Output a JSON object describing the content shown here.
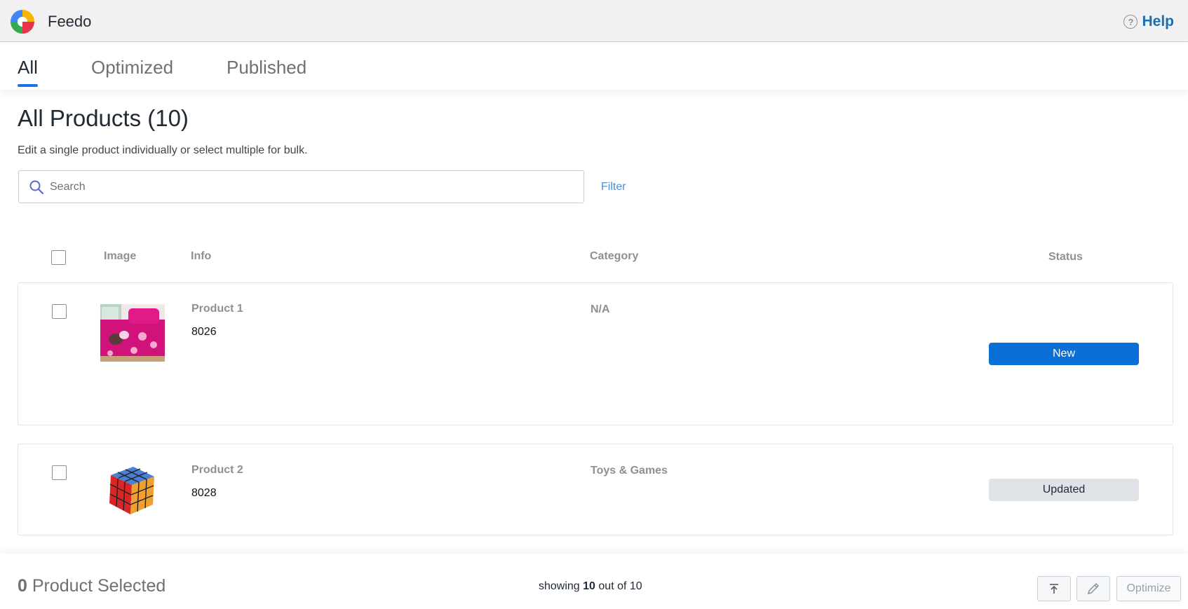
{
  "app": {
    "title": "Feedo",
    "logo_icon": "feedo-logo-icon"
  },
  "help": {
    "label": "Help",
    "icon": "question-circle-icon"
  },
  "tabs": [
    {
      "label": "All",
      "active": true
    },
    {
      "label": "Optimized",
      "active": false
    },
    {
      "label": "Published",
      "active": false
    }
  ],
  "page": {
    "title": "All Products (10)",
    "subtitle": "Edit a single product individually or select multiple for bulk."
  },
  "search": {
    "placeholder": "Search",
    "value": "",
    "icon": "search-icon"
  },
  "filter": {
    "label": "Filter"
  },
  "table": {
    "headers": {
      "image": "Image",
      "info": "Info",
      "category": "Category",
      "status": "Status"
    },
    "rows": [
      {
        "name": "Product 1",
        "sku": "8026",
        "category": "N/A",
        "status": "New",
        "image_icon": "bedsheet-image",
        "checked": false
      },
      {
        "name": "Product 2",
        "sku": "8028",
        "category": "Toys & Games",
        "status": "Updated",
        "image_icon": "rubiks-cube-image",
        "checked": false
      }
    ]
  },
  "footer": {
    "selected_num": "0",
    "selected_label": "Product Selected",
    "showing_prefix": "showing",
    "showing_count": "10",
    "showing_mid": "out of",
    "showing_total": "10",
    "optimize_label": "Optimize",
    "export_icon": "upload-icon",
    "edit_icon": "pencil-icon"
  },
  "colors": {
    "accent": "#1a73e8",
    "status_new": "#0a6fd6",
    "status_updated": "#dfe3e8",
    "help": "#1a6fb5",
    "link": "#4a90d9"
  }
}
